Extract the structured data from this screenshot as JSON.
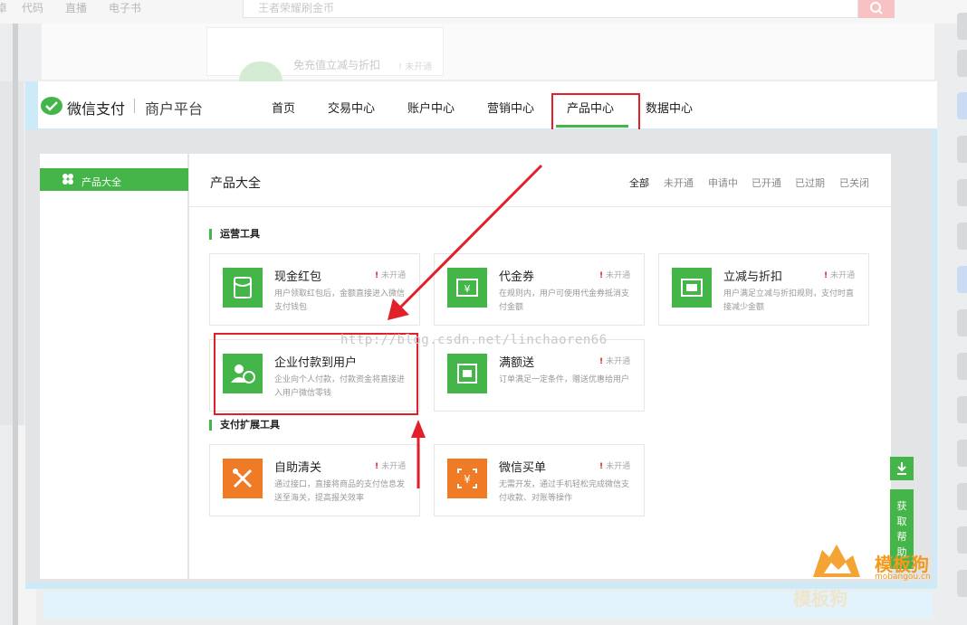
{
  "background": {
    "links": [
      "安卓",
      "代码",
      "直播",
      "电子书"
    ],
    "search_placeholder": "王者荣耀刷金币",
    "card_text": "免充值立减与折扣",
    "card_tag": "! 未开通"
  },
  "header": {
    "brand": "微信支付",
    "brand_sub": "商户平台",
    "nav": [
      "首页",
      "交易中心",
      "账户中心",
      "营销中心",
      "产品中心",
      "数据中心"
    ],
    "active_nav": "产品中心"
  },
  "sidebar": {
    "item_label": "产品大全"
  },
  "main": {
    "title": "产品大全",
    "filters": [
      "全部",
      "未开通",
      "申请中",
      "已开通",
      "已过期",
      "已关闭"
    ],
    "active_filter": "全部",
    "sections": [
      {
        "title": "运营工具",
        "cards": [
          {
            "name": "现金红包",
            "status": "未开通",
            "desc": "用户领取红包后，金额直接进入微信支付钱包",
            "icon": "red-packet-icon"
          },
          {
            "name": "代金券",
            "status": "未开通",
            "desc": "在规则内，用户可使用代金券抵消支付金额",
            "icon": "voucher-icon"
          },
          {
            "name": "立减与折扣",
            "status": "未开通",
            "desc": "用户满足立减与折扣规则，支付时直接减少金额",
            "icon": "discount-icon"
          },
          {
            "name": "企业付款到用户",
            "status": "",
            "desc": "企业向个人付款，付款资金将直接进入用户微信零钱",
            "icon": "enterprise-pay-icon"
          },
          {
            "name": "满额送",
            "status": "未开通",
            "desc": "订单满足一定条件，赠送优惠给用户",
            "icon": "full-gift-icon"
          }
        ]
      },
      {
        "title": "支付扩展工具",
        "cards": [
          {
            "name": "自助清关",
            "status": "未开通",
            "desc": "通过接口，直接将商品的支付信息发送至海关，提高报关效率",
            "icon": "customs-icon"
          },
          {
            "name": "微信买单",
            "status": "未开通",
            "desc": "无需开发，通过手机轻松完成微信支付收款、对账等操作",
            "icon": "wechat-checkout-icon"
          }
        ]
      }
    ]
  },
  "watermark": "http://blog.csdn.net/linchaoren66",
  "float": {
    "help_chars": [
      "获",
      "取",
      "帮",
      "助"
    ]
  },
  "corner_logo": {
    "name": "模板狗",
    "domain": "mobangou.cn"
  },
  "colors": {
    "brand_green": "#44b549",
    "highlight_red": "#e2202a",
    "orange_icon": "#ef7b26",
    "logo_orange": "#f39a1e"
  }
}
